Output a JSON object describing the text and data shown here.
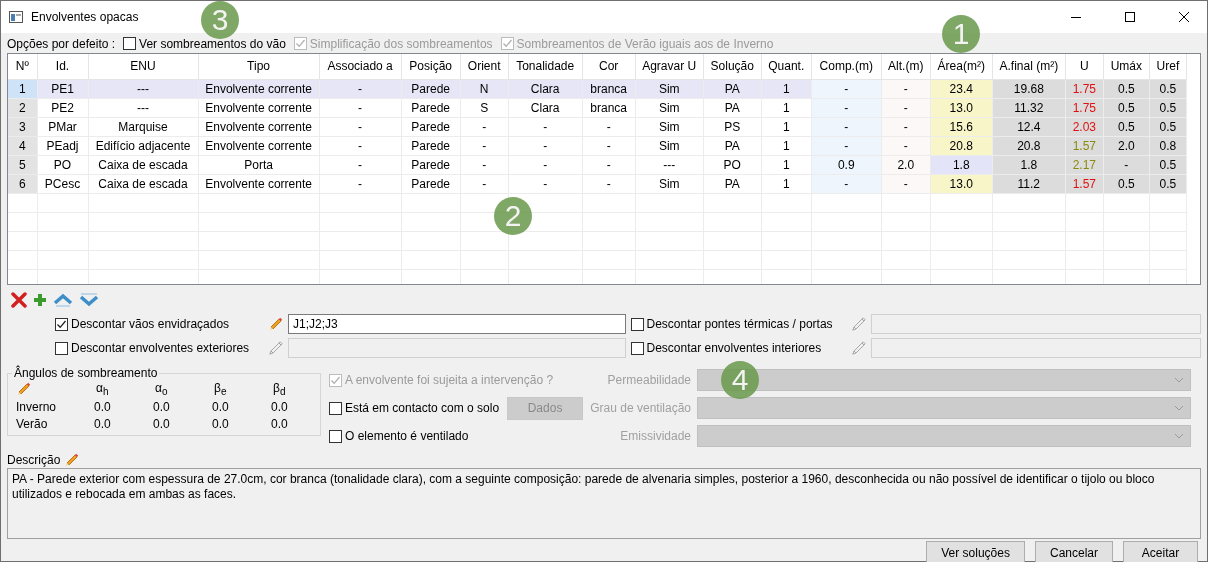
{
  "window": {
    "title": "Envolventes opacas"
  },
  "defaults": {
    "label": "Opções por defeito :",
    "options": [
      {
        "label": "Ver sombreamentos do vão",
        "checked": false,
        "disabled": false
      },
      {
        "label": "Simplificação dos sombreamentos",
        "checked": true,
        "disabled": true
      },
      {
        "label": "Sombreamentos de Verão iguais aos de Inverno",
        "checked": true,
        "disabled": true
      }
    ]
  },
  "table": {
    "columns": [
      {
        "label": "Nº",
        "kind": "index"
      },
      {
        "label": "Id.",
        "kind": "text"
      },
      {
        "label": "ENU",
        "kind": "text"
      },
      {
        "label": "Tipo",
        "kind": "text"
      },
      {
        "label": "Associado a",
        "kind": "text"
      },
      {
        "label": "Posição",
        "kind": "text"
      },
      {
        "label": "Orient",
        "kind": "text"
      },
      {
        "label": "Tonalidade",
        "kind": "text"
      },
      {
        "label": "Cor",
        "kind": "text"
      },
      {
        "label": "Agravar U",
        "kind": "text"
      },
      {
        "label": "Solução",
        "kind": "text"
      },
      {
        "label": "Quant.",
        "kind": "text"
      },
      {
        "label": "Comp.(m)",
        "kind": "length"
      },
      {
        "label": "Alt.(m)",
        "kind": "height"
      },
      {
        "label": "Área(m²)",
        "kind": "area"
      },
      {
        "label": "A.final (m²)",
        "kind": "result"
      },
      {
        "label": "U",
        "kind": "u"
      },
      {
        "label": "Umáx",
        "kind": "result"
      },
      {
        "label": "Uref",
        "kind": "result"
      }
    ],
    "rows": [
      {
        "selected": true,
        "u_over_limit": true,
        "area_computed": false,
        "cells": [
          "1",
          "PE1",
          "---",
          "Envolvente corrente",
          "-",
          "Parede",
          "N",
          "Clara",
          "branca",
          "Sim",
          "PA",
          "1",
          "-",
          "-",
          "23.4",
          "19.68",
          "1.75",
          "0.5",
          "0.5"
        ]
      },
      {
        "selected": false,
        "u_over_limit": true,
        "area_computed": false,
        "cells": [
          "2",
          "PE2",
          "---",
          "Envolvente corrente",
          "-",
          "Parede",
          "S",
          "Clara",
          "branca",
          "Sim",
          "PA",
          "1",
          "-",
          "-",
          "13.0",
          "11.32",
          "1.75",
          "0.5",
          "0.5"
        ]
      },
      {
        "selected": false,
        "u_over_limit": true,
        "area_computed": false,
        "cells": [
          "3",
          "PMar",
          "Marquise",
          "Envolvente corrente",
          "-",
          "Parede",
          "-",
          "-",
          "-",
          "Sim",
          "PS",
          "1",
          "-",
          "-",
          "15.6",
          "12.4",
          "2.03",
          "0.5",
          "0.5"
        ]
      },
      {
        "selected": false,
        "u_over_limit": false,
        "area_computed": false,
        "cells": [
          "4",
          "PEadj",
          "Edifício adjacente",
          "Envolvente corrente",
          "-",
          "Parede",
          "-",
          "-",
          "-",
          "Sim",
          "PA",
          "1",
          "-",
          "-",
          "20.8",
          "20.8",
          "1.57",
          "2.0",
          "0.8"
        ]
      },
      {
        "selected": false,
        "u_over_limit": false,
        "area_computed": true,
        "cells": [
          "5",
          "PO",
          "Caixa de escada",
          "Porta",
          "-",
          "Parede",
          "-",
          "-",
          "-",
          "---",
          "PO",
          "1",
          "0.9",
          "2.0",
          "1.8",
          "1.8",
          "2.17",
          "-",
          "0.5"
        ]
      },
      {
        "selected": false,
        "u_over_limit": true,
        "area_computed": false,
        "cells": [
          "6",
          "PCesc",
          "Caixa de escada",
          "Envolvente corrente",
          "-",
          "Parede",
          "-",
          "-",
          "-",
          "Sim",
          "PA",
          "1",
          "-",
          "-",
          "13.0",
          "11.2",
          "1.57",
          "0.5",
          "0.5"
        ]
      }
    ]
  },
  "discounts": [
    {
      "label": "Descontar vãos envidraçados",
      "checked": true,
      "value": "J1;J2;J3"
    },
    {
      "label": "Descontar pontes térmicas / portas",
      "checked": false
    },
    {
      "label": "Descontar envolventes exteriores",
      "checked": false
    },
    {
      "label": "Descontar envolventes interiores",
      "checked": false
    }
  ],
  "shading_angles": {
    "title": "Ângulos de sombreamento",
    "headers": [
      "α$_{h}$",
      "α$_{o}$",
      "β$_{e}$",
      "β$_{d}$"
    ],
    "rows": [
      {
        "label": "Inverno",
        "values": [
          "0.0",
          "0.0",
          "0.0",
          "0.0"
        ]
      },
      {
        "label": "Verão",
        "values": [
          "0.0",
          "0.0",
          "0.0",
          "0.0"
        ]
      }
    ]
  },
  "element": {
    "checks": [
      {
        "label": "A envolvente foi sujeita a intervenção ?",
        "checked": true,
        "disabled": true
      },
      {
        "label": "Está em contacto com o solo",
        "checked": false,
        "disabled": false,
        "button": {
          "label": "Dados",
          "disabled": true
        }
      },
      {
        "label": "O elemento é ventilado",
        "checked": false,
        "disabled": false
      }
    ],
    "selects": [
      {
        "label": "Permeabilidade",
        "disabled": true
      },
      {
        "label": "Grau de ventilação",
        "disabled": true
      },
      {
        "label": "Emissividade",
        "disabled": true
      }
    ]
  },
  "description": {
    "label": "Descrição",
    "text": "PA - Parede exterior com espessura de 27.0cm, cor branca (tonalidade clara), com a seguinte composição: parede de alvenaria simples, posterior a 1960, desconhecida ou não possível de identificar o tijolo ou bloco utilizados e rebocada em ambas as faces."
  },
  "buttons": [
    "Ver soluções",
    "Cancelar",
    "Aceitar"
  ],
  "callouts": [
    {
      "number": "3"
    },
    {
      "number": "1"
    },
    {
      "number": "2"
    },
    {
      "number": "4"
    }
  ]
}
